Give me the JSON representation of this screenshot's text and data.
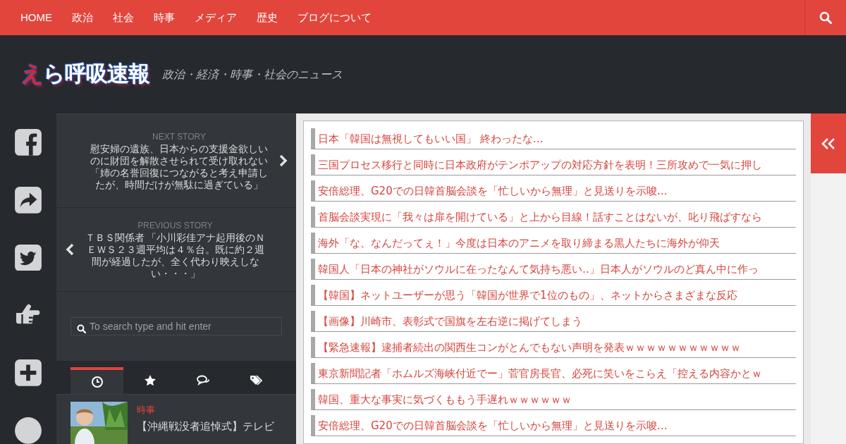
{
  "nav": {
    "items": [
      {
        "label": "HOME"
      },
      {
        "label": "政治"
      },
      {
        "label": "社会"
      },
      {
        "label": "時事"
      },
      {
        "label": "メディア"
      },
      {
        "label": "歴史"
      },
      {
        "label": "ブログについて"
      }
    ]
  },
  "header": {
    "logo_parts": [
      {
        "text": "え",
        "color": "#e8202a"
      },
      {
        "text": "ら呼吸速報",
        "color": "#ffffff"
      }
    ],
    "tagline": "政治・経済・時事・社会のニュース"
  },
  "share_buttons": [
    {
      "kind": "facebook"
    },
    {
      "kind": "share"
    },
    {
      "kind": "twitter"
    },
    {
      "kind": "like"
    },
    {
      "kind": "plus"
    },
    {
      "kind": "circle"
    }
  ],
  "sidebar": {
    "next_story": {
      "label": "NEXT STORY",
      "title": "慰安婦の遺族、日本からの支援金欲しいのに財団を解散させられて受け取れない「姉の名誉回復につながると考え申請したが、時間だけが無駄に過ぎている」"
    },
    "previous_story": {
      "label": "PREVIOUS STORY",
      "title": "ＴＢＳ関係者 「小川彩佳アナ起用後のＮＥＷＳ２３週平均は４％台。既に約２週間が経過したが、全く代わり映えしない・・・」"
    },
    "search": {
      "placeholder": "To search type and hit enter"
    },
    "tabs": [
      {
        "kind": "recent",
        "selected": true
      },
      {
        "kind": "popular",
        "selected": false
      },
      {
        "kind": "comments",
        "selected": false
      },
      {
        "kind": "tags",
        "selected": false
      }
    ],
    "posts": [
      {
        "category": "時事",
        "title": "【沖縄戦没者追悼式】テレビ"
      }
    ]
  },
  "headlines": [
    "日本「韓国は無視してもいい国」 終わったな…",
    "三国プロセス移行と同時に日本政府がテンポアップの対応方針を表明！三所攻めで一気に押し",
    "安倍総理、G20での日韓首脳会談を「忙しいから無理」と見送りを示唆…",
    "首脳会談実現に「我々は扉を開けている」と上から目線！話すことはないが、叱り飛ばすなら",
    "海外「な、なんだってぇ！」今度は日本のアニメを取り締まる黒人たちに海外が仰天",
    "韓国人「日本の神社がソウルに在ったなんて気持ち悪い‥」日本人がソウルのど真ん中に作っ",
    "【韓国】ネットユーザーが思う「韓国が世界で1位のもの」、ネットからさまざまな反応",
    "【画像】川崎市、表彰式で国旗を左右逆に掲げてしまう",
    "【緊急速報】逮捕者続出の関西生コンがとんでもない声明を発表ｗｗｗｗｗｗｗｗｗｗｗ",
    "東京新聞記者「ホムルズ海峡付近でー」菅官房長官、必死に笑いをこらえ「控える内容かとｗ",
    "韓国、重大な事実に気づくももう手遅れｗｗｗｗｗｗ",
    "安倍総理、G20での日韓首脳会談を「忙しいから無理」と見送りを示唆…"
  ]
}
